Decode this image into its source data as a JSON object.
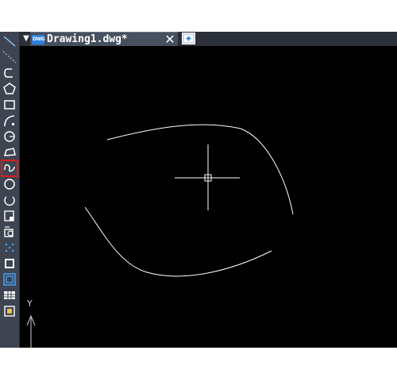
{
  "tab": {
    "menu_arrow": "▼",
    "badge": "DWG",
    "title": "Drawing1.dwg*",
    "close": "✕"
  },
  "toolbar": {
    "tools": [
      "line",
      "construction-line",
      "polyline",
      "polygon",
      "rectangle",
      "arc",
      "circle",
      "revision-cloud",
      "spline",
      "ellipse",
      "ellipse-arc",
      "insert-block",
      "make-block",
      "point",
      "hatch",
      "region",
      "table",
      "multiline-text"
    ],
    "selected_tool": "spline",
    "selected_color": "#e01b1b"
  },
  "canvas": {
    "background": "#000000",
    "ucs_axis_label": "Y"
  }
}
